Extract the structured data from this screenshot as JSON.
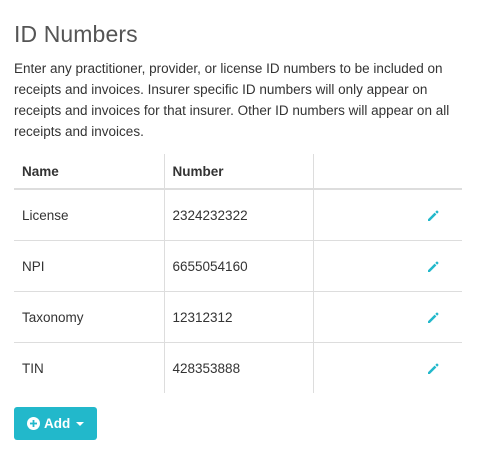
{
  "page": {
    "title": "ID Numbers",
    "description": "Enter any practitioner, provider, or license ID numbers to be included on receipts and invoices. Insurer specific ID numbers will only appear on receipts and invoices for that insurer. Other ID numbers will appear on all receipts and invoices."
  },
  "table": {
    "headers": {
      "name": "Name",
      "number": "Number",
      "actions": ""
    },
    "rows": [
      {
        "name": "License",
        "number": "2324232322",
        "action_icon": "pencil-icon"
      },
      {
        "name": "NPI",
        "number": "6655054160",
        "action_icon": "pencil-icon"
      },
      {
        "name": "Taxonomy",
        "number": "12312312",
        "action_icon": "pencil-icon"
      },
      {
        "name": "TIN",
        "number": "428353888",
        "action_icon": "pencil-icon"
      }
    ]
  },
  "add_button": {
    "label": "Add",
    "icon": "plus-circle-icon",
    "dropdown_icon": "caret-down-icon"
  },
  "colors": {
    "accent": "#22b8cb",
    "border": "#dddddd",
    "title": "#555555",
    "text": "#333333"
  }
}
